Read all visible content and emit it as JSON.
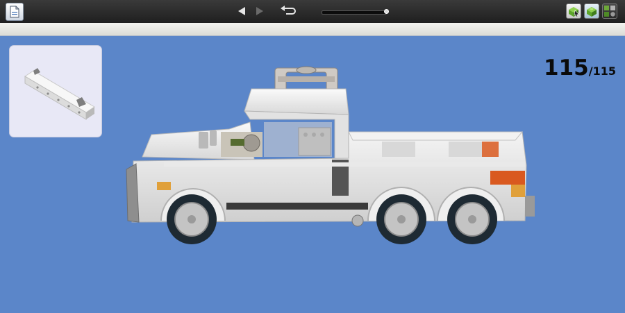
{
  "toolbar": {
    "document_icon": "document-icon",
    "prev_icon": "triangle-left-icon",
    "next_icon": "triangle-right-icon",
    "reset_icon": "rotate-back-icon",
    "step_slider_position": 1.0,
    "view_buttons": [
      {
        "icon": "brick-cursor-icon"
      },
      {
        "icon": "brick-3d-icon"
      },
      {
        "icon": "brick-parts-icon"
      }
    ]
  },
  "part_preview": {
    "icon": "lego-brick-part-icon"
  },
  "step": {
    "current": "115",
    "total": "/115"
  },
  "colors": {
    "background": "#5b86c9",
    "toolbar": "#2a2a2a",
    "truck_body": "#e6e6e6",
    "tail_light": "#d9591f"
  }
}
